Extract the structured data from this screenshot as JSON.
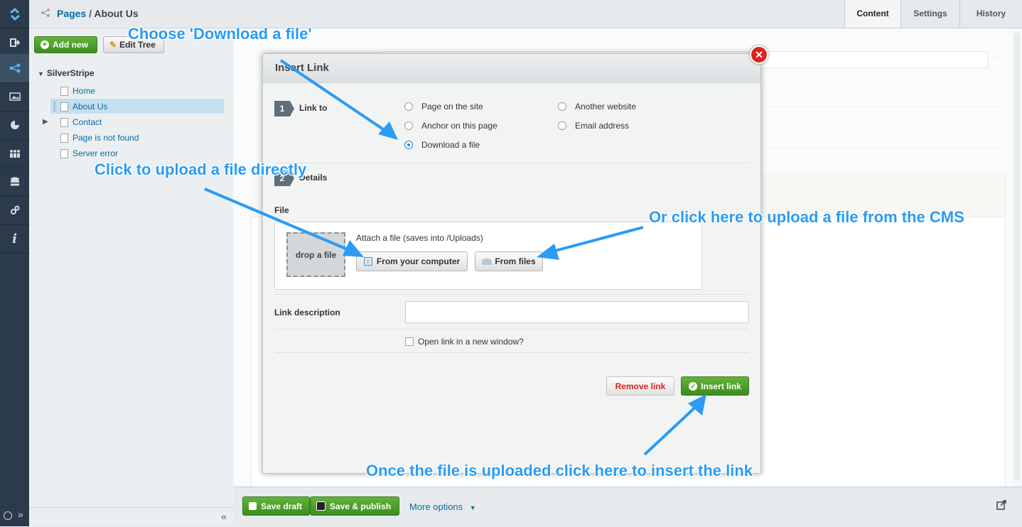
{
  "breadcrumb": {
    "parent": "Pages",
    "separator": "/",
    "current": "About Us"
  },
  "tabs": [
    {
      "label": "Content"
    },
    {
      "label": "Settings"
    },
    {
      "label": "History"
    }
  ],
  "tree_toolbar": {
    "add_new": "Add new",
    "edit_tree": "Edit Tree"
  },
  "tree": {
    "root": "SilverStripe",
    "items": [
      {
        "label": "Home"
      },
      {
        "label": "About Us"
      },
      {
        "label": "Contact"
      },
      {
        "label": "Page is not found"
      },
      {
        "label": "Server error"
      }
    ]
  },
  "dialog": {
    "title": "Insert Link",
    "step1": {
      "number": "1",
      "label": "Link to"
    },
    "options": [
      {
        "label": "Page on the site"
      },
      {
        "label": "Another website"
      },
      {
        "label": "Anchor on this page"
      },
      {
        "label": "Email address"
      },
      {
        "label": "Download a file"
      }
    ],
    "selected_option": "Download a file",
    "step2": {
      "number": "2",
      "label": "Details"
    },
    "file_label": "File",
    "drop_label": "drop a file",
    "attach_text": "Attach a file (saves into /Uploads)",
    "from_computer": "From your computer",
    "from_files": "From files",
    "link_description_label": "Link description",
    "link_description_value": "",
    "new_window_label": "Open link in a new window?",
    "remove_link": "Remove link",
    "insert_link": "Insert link"
  },
  "bottom": {
    "save_draft": "Save draft",
    "save_publish": "Save & publish",
    "more_options": "More options"
  },
  "annotations": {
    "choose": "Choose 'Download a file'",
    "upload_direct": "Click to upload a file directly",
    "upload_cms": "Or click here to upload a file from the CMS",
    "insert": "Once the file is uploaded click here to insert the link"
  },
  "colors": {
    "accent_blue": "#2b9bf4",
    "primary_green": "#4a9d2a",
    "rail_dark": "#2c3b4c",
    "danger_red": "#d9261c"
  }
}
